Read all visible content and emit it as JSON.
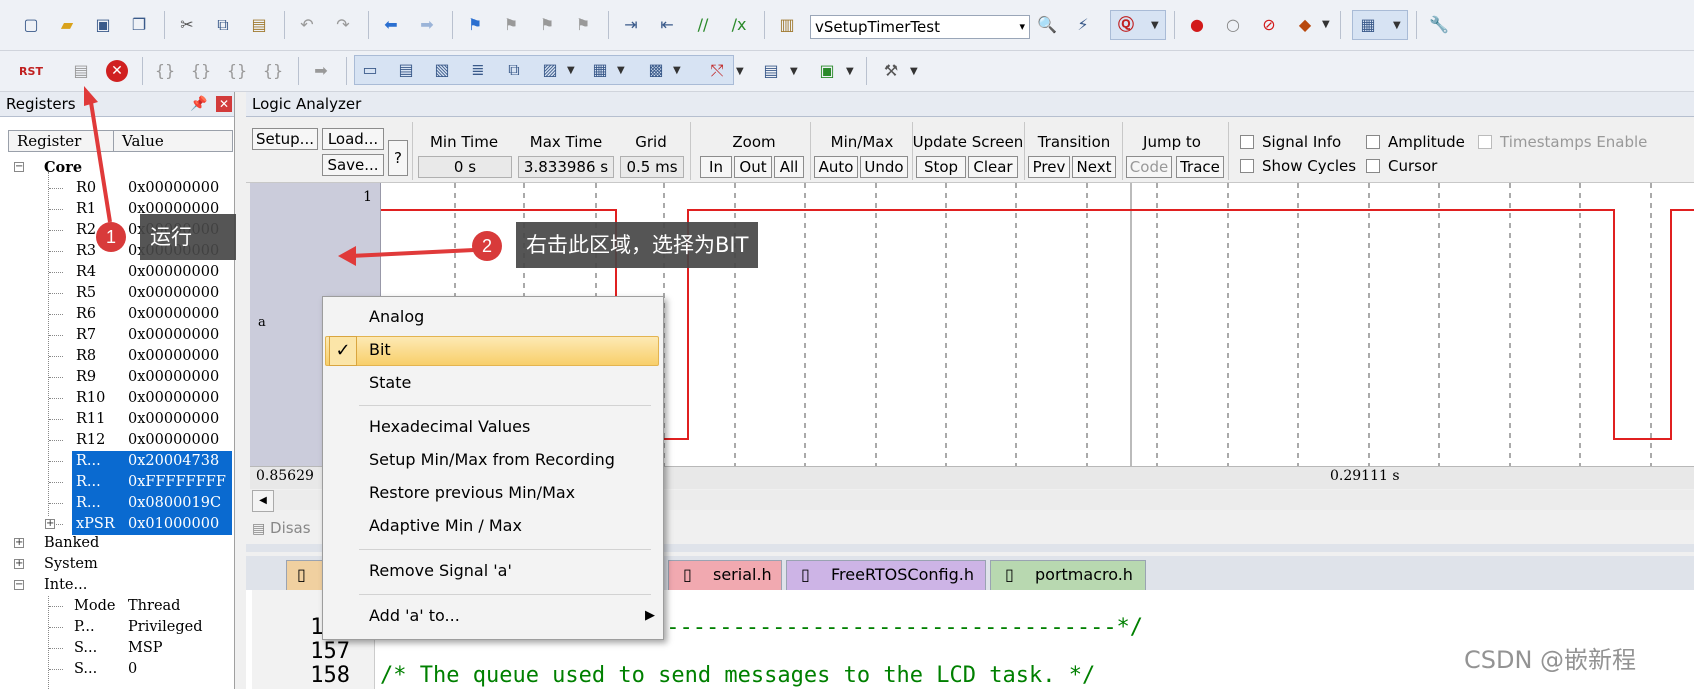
{
  "toolbar": {
    "target_combo": "vSetupTimerTest"
  },
  "registers": {
    "title": "Registers",
    "columns": [
      "Register",
      "Value"
    ],
    "core_label": "Core",
    "rows": [
      {
        "name": "R0",
        "value": "0x00000000"
      },
      {
        "name": "R1",
        "value": "0x00000000"
      },
      {
        "name": "R2",
        "value": "0x00000000"
      },
      {
        "name": "R3",
        "value": "0x00000000"
      },
      {
        "name": "R4",
        "value": "0x00000000"
      },
      {
        "name": "R5",
        "value": "0x00000000"
      },
      {
        "name": "R6",
        "value": "0x00000000"
      },
      {
        "name": "R7",
        "value": "0x00000000"
      },
      {
        "name": "R8",
        "value": "0x00000000"
      },
      {
        "name": "R9",
        "value": "0x00000000"
      },
      {
        "name": "R10",
        "value": "0x00000000"
      },
      {
        "name": "R11",
        "value": "0x00000000"
      },
      {
        "name": "R12",
        "value": "0x00000000"
      },
      {
        "name": "R...",
        "value": "0x20004738"
      },
      {
        "name": "R...",
        "value": "0xFFFFFFFF"
      },
      {
        "name": "R...",
        "value": "0x0800019C"
      },
      {
        "name": "xPSR",
        "value": "0x01000000"
      }
    ],
    "groups": [
      "Banked",
      "System",
      "Inte..."
    ],
    "internal": [
      {
        "name": "Mode",
        "value": "Thread"
      },
      {
        "name": "P...",
        "value": "Privileged"
      },
      {
        "name": "S...",
        "value": "MSP"
      },
      {
        "name": "S...",
        "value": "0"
      }
    ]
  },
  "logic_analyzer": {
    "title": "Logic Analyzer",
    "setup": "Setup...",
    "load": "Load...",
    "save": "Save...",
    "help": "?",
    "min_time_label": "Min Time",
    "min_time": "0 s",
    "max_time_label": "Max Time",
    "max_time": "3.833986 s",
    "grid_label": "Grid",
    "grid": "0.5 ms",
    "zoom_label": "Zoom",
    "zoom_in": "In",
    "zoom_out": "Out",
    "zoom_all": "All",
    "minmax_label": "Min/Max",
    "minmax_auto": "Auto",
    "minmax_undo": "Undo",
    "update_label": "Update Screen",
    "update_stop": "Stop",
    "update_clear": "Clear",
    "transition_label": "Transition",
    "transition_prev": "Prev",
    "transition_next": "Next",
    "jump_label": "Jump to",
    "jump_code": "Code",
    "jump_trace": "Trace",
    "signal_info": "Signal Info",
    "show_cycles": "Show Cycles",
    "amplitude": "Amplitude",
    "cursor": "Cursor",
    "timestamps": "Timestamps Enable",
    "signal_index": "1",
    "signal_name": "a",
    "time_left": "0.85629",
    "time_center": "0.29111 s",
    "disasm_tab": "Disas"
  },
  "context_menu": {
    "items": [
      {
        "label": "Analog",
        "checked": false
      },
      {
        "label": "Bit",
        "checked": true
      },
      {
        "label": "State",
        "checked": false
      },
      {
        "label": "Hexadecimal Values",
        "checked": false
      },
      {
        "label": "Setup Min/Max from Recording",
        "checked": false
      },
      {
        "label": "Restore previous Min/Max",
        "checked": false
      },
      {
        "label": "Adaptive Min / Max",
        "checked": false
      },
      {
        "label": "Remove Signal 'a'",
        "checked": false
      },
      {
        "label": "Add 'a' to...",
        "checked": false
      }
    ]
  },
  "annotations": {
    "one_num": "1",
    "one_text": "运行",
    "two_num": "2",
    "two_text": "右击此区域，选择为BIT"
  },
  "editor": {
    "tabs": [
      "serial.h",
      "FreeRTOSConfig.h",
      "portmacro.h"
    ],
    "tab_colors": [
      "#f1a9b0",
      "#cdb4e6",
      "#b8d8b0"
    ],
    "lines": [
      {
        "num": "1",
        "text": ""
      },
      {
        "num": "156",
        "text": "---------------------------------------*/"
      },
      {
        "num": "157",
        "text": ""
      },
      {
        "num": "158",
        "text": "/* The queue used to send messages to the LCD task. */"
      }
    ]
  },
  "watermark": "CSDN @嵌新程",
  "colors": {
    "signal": "#e02020",
    "selection": "#0a6ad0",
    "badge": "#d83a3a"
  }
}
